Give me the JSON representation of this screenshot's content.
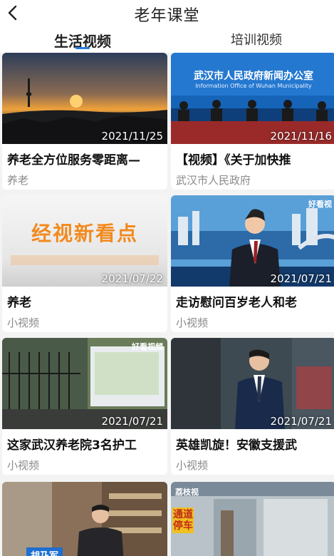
{
  "header": {
    "title": "老年课堂"
  },
  "tabs": [
    {
      "label": "生活视频"
    },
    {
      "label": "培训视频"
    }
  ],
  "videos": [
    {
      "title": "养老全方位服务零距离—",
      "source": "养老",
      "date": "2021/11/25"
    },
    {
      "title": "【视频】《关于加快推",
      "source": "武汉市人民政府",
      "date": "2021/11/16",
      "overlay": {
        "heading": "武汉市人民政府新闻办公室",
        "subheading": "Information Office of Wuhan Municipality"
      }
    },
    {
      "title": "养老",
      "source": "小视频",
      "date": "2021/07/22",
      "overlay": {
        "text": "经视新看点"
      }
    },
    {
      "title": "走访慰问百岁老人和老",
      "source": "小视频",
      "date": "2021/07/21",
      "overlay": {
        "brand": "好看视"
      }
    },
    {
      "title": "这家武汉养老院3名护工",
      "source": "小视频",
      "date": "2021/07/21",
      "overlay": {
        "brand": "好看视频"
      }
    },
    {
      "title": "英雄凯旋！安徽支援武",
      "source": "小视频",
      "date": "2021/07/21"
    },
    {
      "title": "",
      "source": "",
      "date": "",
      "overlay": {
        "caption": "胡乃军"
      }
    },
    {
      "title": "",
      "source": "",
      "date": "",
      "overlay": {
        "sign": "通道停车",
        "brand": "荔枝视"
      }
    }
  ],
  "colors": {
    "accent": "#2a7de1",
    "background": "#f3f3f3"
  },
  "icons": {
    "back": "back-chevron-icon",
    "play": "play-icon"
  }
}
